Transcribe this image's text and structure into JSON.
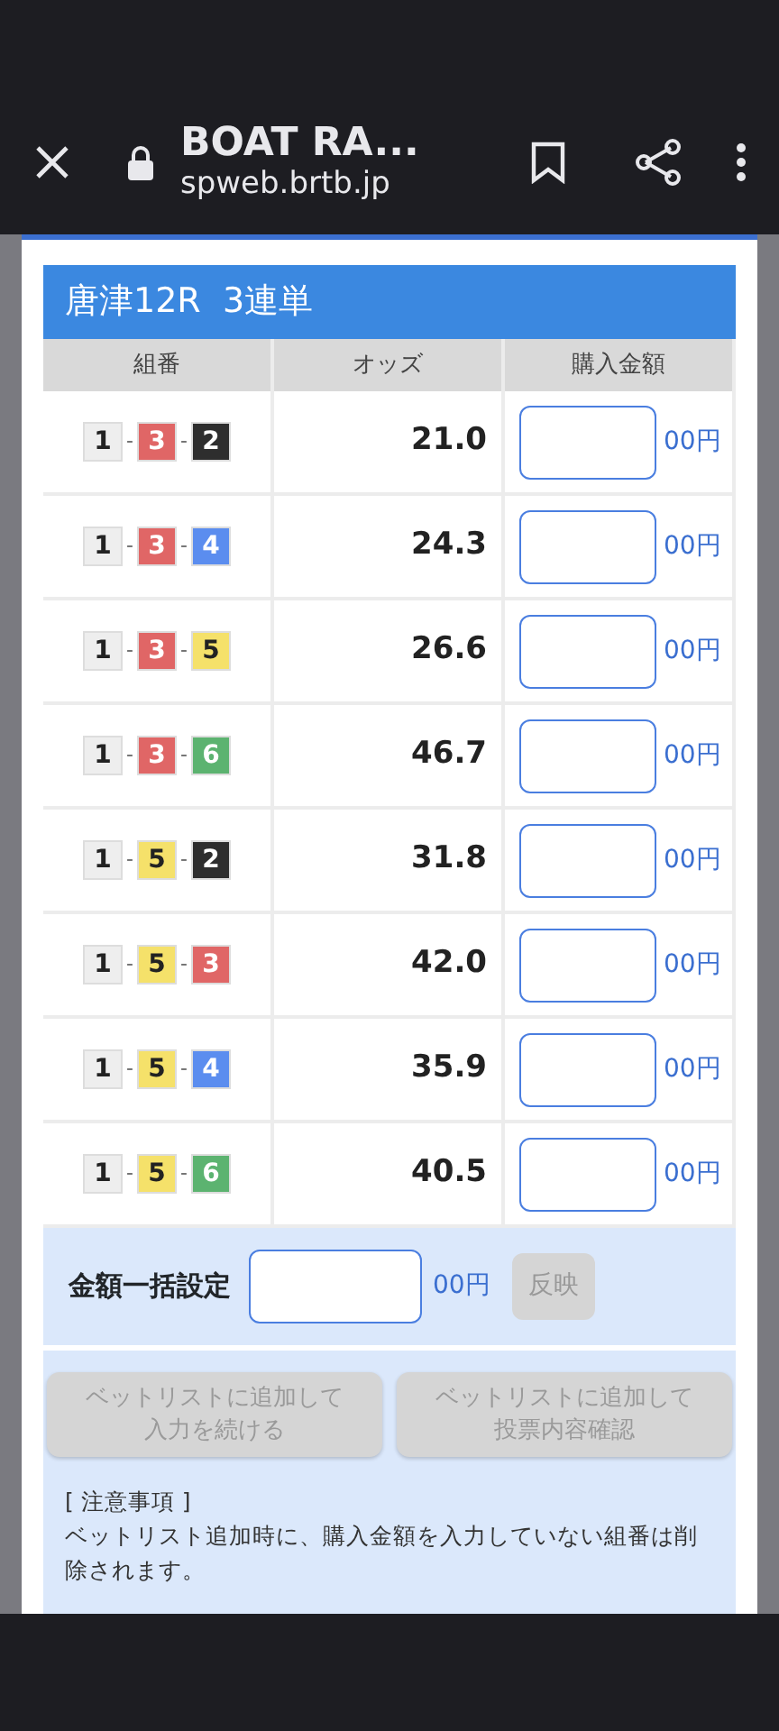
{
  "browser": {
    "title": "BOAT RA...",
    "url": "spweb.brtb.jp"
  },
  "modal": {
    "title": "唐津12R  3連単",
    "columns": [
      "組番",
      "オッズ",
      "購入金額"
    ],
    "rows": [
      {
        "boats": [
          {
            "num": "1",
            "color": "#eeeeee"
          },
          {
            "num": "3",
            "color": "#e06666"
          },
          {
            "num": "2",
            "color": "#2e2e2e"
          }
        ],
        "separators": [
          "-",
          "-"
        ],
        "odds": "21.0",
        "unit": "00円"
      },
      {
        "boats": [
          {
            "num": "1",
            "color": "#eeeeee"
          },
          {
            "num": "3",
            "color": "#e06666"
          },
          {
            "num": "4",
            "color": "#5b8def"
          }
        ],
        "separators": [
          "-",
          "-"
        ],
        "odds": "24.3",
        "unit": "00円"
      },
      {
        "boats": [
          {
            "num": "1",
            "color": "#eeeeee"
          },
          {
            "num": "3",
            "color": "#e06666"
          },
          {
            "num": "5",
            "color": "#f5e16a"
          }
        ],
        "separators": [
          "-",
          "-"
        ],
        "odds": "26.6",
        "unit": "00円"
      },
      {
        "boats": [
          {
            "num": "1",
            "color": "#eeeeee"
          },
          {
            "num": "3",
            "color": "#e06666"
          },
          {
            "num": "6",
            "color": "#5cb370"
          }
        ],
        "separators": [
          "-",
          "-"
        ],
        "odds": "46.7",
        "unit": "00円"
      },
      {
        "boats": [
          {
            "num": "1",
            "color": "#eeeeee"
          },
          {
            "num": "5",
            "color": "#f5e16a"
          },
          {
            "num": "2",
            "color": "#2e2e2e"
          }
        ],
        "separators": [
          "-",
          "-"
        ],
        "odds": "31.8",
        "unit": "00円"
      },
      {
        "boats": [
          {
            "num": "1",
            "color": "#eeeeee"
          },
          {
            "num": "5",
            "color": "#f5e16a"
          },
          {
            "num": "3",
            "color": "#e06666"
          }
        ],
        "separators": [
          "-",
          "-"
        ],
        "odds": "42.0",
        "unit": "00円"
      },
      {
        "boats": [
          {
            "num": "1",
            "color": "#eeeeee"
          },
          {
            "num": "5",
            "color": "#f5e16a"
          },
          {
            "num": "4",
            "color": "#5b8def"
          }
        ],
        "separators": [
          "-",
          "-"
        ],
        "odds": "35.9",
        "unit": "00円"
      },
      {
        "boats": [
          {
            "num": "1",
            "color": "#eeeeee"
          },
          {
            "num": "5",
            "color": "#f5e16a"
          },
          {
            "num": "6",
            "color": "#5cb370"
          }
        ],
        "separators": [
          "-",
          "-"
        ],
        "odds": "40.5",
        "unit": "00円"
      }
    ],
    "bulk": {
      "label": "金額一括設定",
      "unit": "00円",
      "apply": {
        "label": "反映",
        "disabled": true
      }
    },
    "actions": [
      {
        "label": "ベットリストに追加して入力を続ける",
        "disabled": true
      },
      {
        "label": "ベットリストに追加して投票内容確認",
        "disabled": true
      }
    ],
    "notes_title": "[ 注意事項 ]",
    "notes": "ベットリスト追加時に、購入金額を入力していない組番は削除されます。"
  }
}
